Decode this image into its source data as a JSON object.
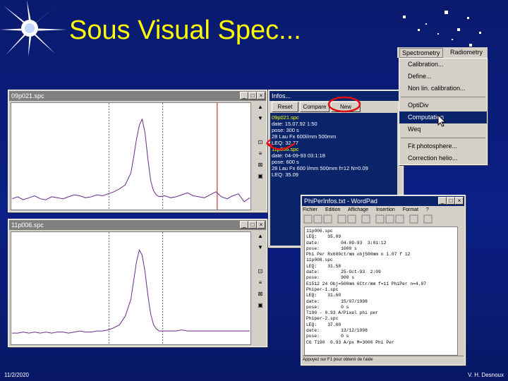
{
  "slide": {
    "title": "Sous Visual Spec...",
    "date": "11/2/2020",
    "author": "V. H. Desnoux"
  },
  "spec_window_1": {
    "title": "09p021.spc",
    "title_buttons": [
      "_",
      "□",
      "×"
    ]
  },
  "spec_window_2": {
    "title": "11p006.spc",
    "title_buttons": [
      "_",
      "□",
      "×"
    ]
  },
  "info_window": {
    "title": "Infos...",
    "buttons": [
      "Reset",
      "Compare",
      "New"
    ],
    "lines": [
      {
        "label": "09p021.spc",
        "value": ""
      },
      {
        "label": "date:",
        "value": "15.07.92 1:50"
      },
      {
        "label": "pose:",
        "value": "300 s"
      },
      {
        "label": "28 Lau Fx 600l/mm 500mm",
        "value": ""
      },
      {
        "label": "LEQ:",
        "value": "32.77"
      },
      {
        "label": "11p006.spc",
        "value": ""
      },
      {
        "label": "date:",
        "value": "04-09-93 03:1:18"
      },
      {
        "label": "pose:",
        "value": "600 s"
      },
      {
        "label": "28 Lau Fx 600 l/mm 500mm f=12 N=0.09",
        "value": ""
      },
      {
        "label": "LEQ:",
        "value": "35.09"
      }
    ]
  },
  "menu": {
    "bar": [
      "Spectrometry",
      "Radiometry"
    ],
    "items": [
      "Calibration...",
      "Define...",
      "Non lin. calibration...",
      "OptiDiv",
      "Computation",
      "Weq",
      "Fit photosphere...",
      "Correction helio..."
    ],
    "highlighted_index": 4
  },
  "notepad": {
    "title": "PhiPerInfos.txt - WordPad",
    "menus": [
      "Fichier",
      "Edition",
      "Affichage",
      "Insertion",
      "Format",
      "?"
    ],
    "lines": [
      "11p006.spc",
      "LEQ:    35.09",
      "date:        04-09-93  3:01:12",
      "pose:        1000 s",
      "Phi Per Rx600ct/mm obj500mm n 1.07 f 12",
      "11p008.spc",
      "LEQ:    31.58",
      "date:        25-Oct-93  2:09",
      "pose:        900 s",
      "E1512 24 Obj=500mm 6Ctr/mm f=11 PhiPer n=4.07",
      "Phiper-1.spc",
      "LEQ:    31.60",
      "date:        15/07/1998",
      "pose:        0 s",
      "T190 - 0.93 A/Pixel phi per",
      "Phiper-2.spc",
      "LEQ:    37.00",
      "date:        13/12/1998",
      "pose:        0 s",
      "CG T190  0.93 A/px M=3000 Phi Per"
    ],
    "status": "Appuyez sur F1 pour obtenir de l'aide"
  },
  "chart_data": [
    {
      "type": "line",
      "title": "09p021.spc",
      "x": [
        0,
        8,
        16,
        24,
        32,
        40,
        48,
        56,
        64,
        72,
        80,
        88,
        96,
        104,
        112,
        120,
        128,
        136,
        144,
        152,
        160,
        168,
        172,
        176,
        180,
        184,
        188,
        192,
        196,
        200,
        204,
        208,
        216,
        224,
        232,
        240,
        248,
        256,
        264,
        272,
        280,
        288,
        296,
        304,
        312,
        320,
        328,
        336
      ],
      "y": [
        0.08,
        0.1,
        0.07,
        0.09,
        0.11,
        0.08,
        0.07,
        0.1,
        0.09,
        0.08,
        0.1,
        0.12,
        0.11,
        0.09,
        0.1,
        0.12,
        0.11,
        0.13,
        0.15,
        0.18,
        0.22,
        0.34,
        0.5,
        0.68,
        0.82,
        0.88,
        0.74,
        0.48,
        0.26,
        0.16,
        0.12,
        0.1,
        0.11,
        0.09,
        0.1,
        0.12,
        0.14,
        0.11,
        0.1,
        0.09,
        0.12,
        0.15,
        0.1,
        0.08,
        0.11,
        0.13,
        0.05,
        0.09
      ],
      "ylim": [
        0,
        1
      ],
      "markers": [
        {
          "x": 137,
          "style": "dashed"
        },
        {
          "x": 213,
          "style": "dashed"
        },
        {
          "x": 290,
          "style": "solid-red"
        }
      ]
    },
    {
      "type": "line",
      "title": "11p006.spc",
      "x": [
        0,
        8,
        16,
        24,
        32,
        40,
        48,
        56,
        64,
        72,
        80,
        88,
        96,
        104,
        112,
        120,
        128,
        136,
        144,
        152,
        160,
        168,
        172,
        176,
        180,
        184,
        188,
        192,
        196,
        200,
        204,
        208,
        216,
        224,
        232,
        240,
        248,
        256,
        264,
        272,
        280,
        288,
        296,
        304,
        312,
        320,
        328,
        336
      ],
      "y": [
        0.08,
        0.08,
        0.09,
        0.08,
        0.09,
        0.08,
        0.09,
        0.08,
        0.09,
        0.09,
        0.08,
        0.09,
        0.1,
        0.09,
        0.09,
        0.1,
        0.1,
        0.11,
        0.13,
        0.16,
        0.24,
        0.4,
        0.58,
        0.76,
        0.87,
        0.82,
        0.66,
        0.44,
        0.26,
        0.16,
        0.12,
        0.1,
        0.1,
        0.1,
        0.1,
        0.11,
        0.1,
        0.1,
        0.1,
        0.1,
        0.1,
        0.1,
        0.1,
        0.1,
        0.1,
        0.1,
        0.1,
        0.1
      ],
      "ylim": [
        0,
        1
      ],
      "markers": [
        {
          "x": 137,
          "style": "dashed"
        },
        {
          "x": 213,
          "style": "dashed"
        }
      ]
    }
  ]
}
